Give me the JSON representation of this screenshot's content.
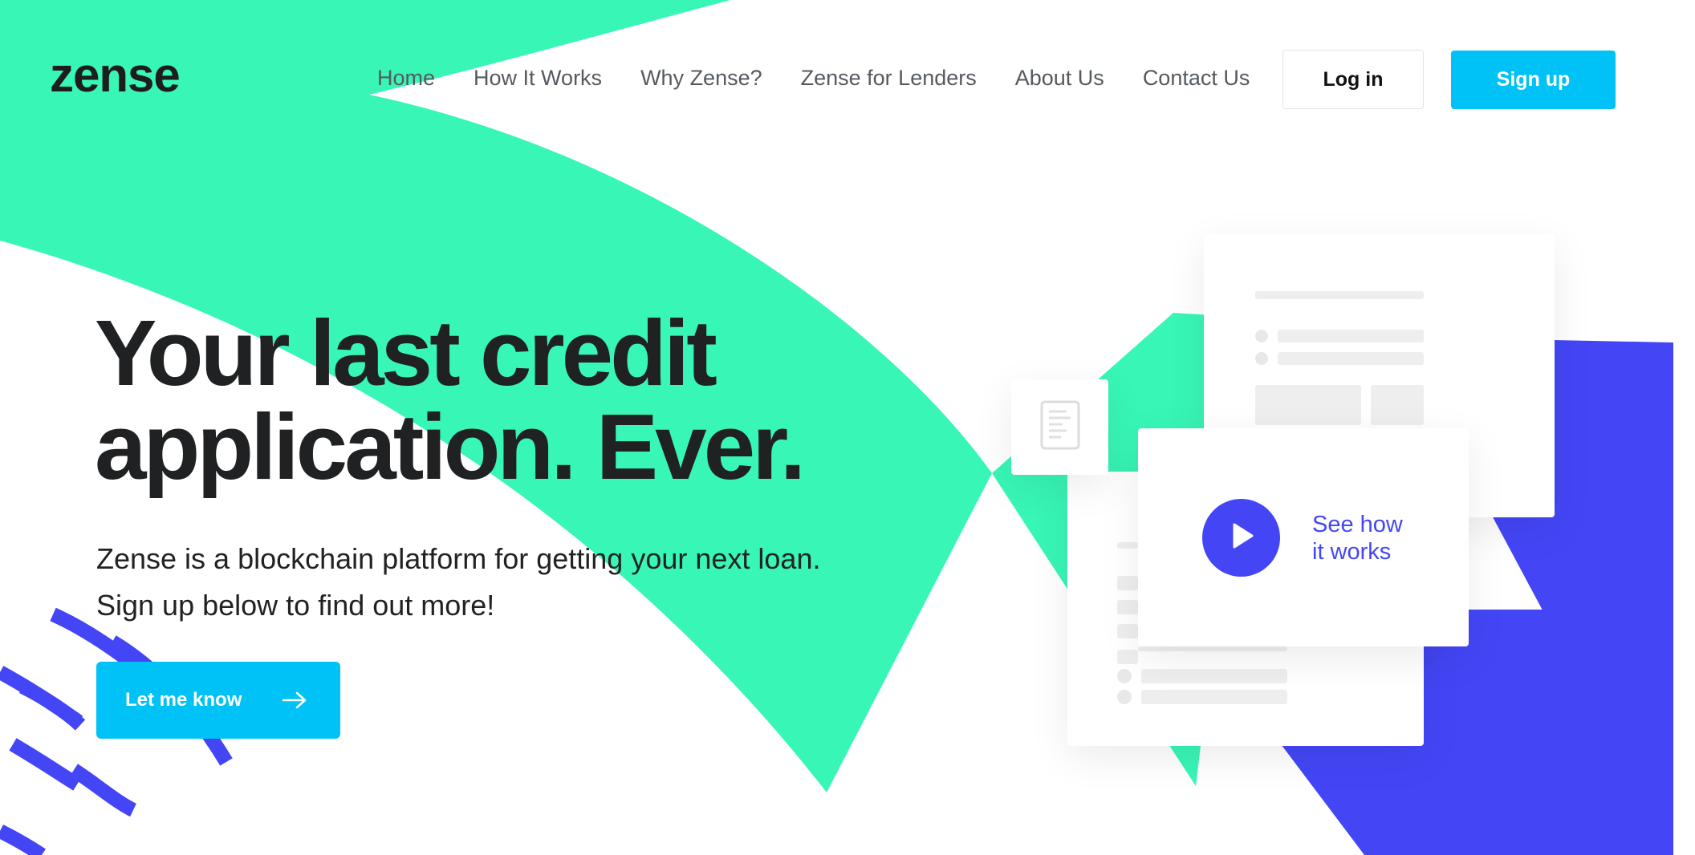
{
  "brand": {
    "logo_text": "zense",
    "colors": {
      "mint": "#38f6b6",
      "indigo": "#4446f6",
      "cyan": "#00c2f6",
      "text_dark": "#1f2122"
    }
  },
  "nav": {
    "items": [
      {
        "label": "Home"
      },
      {
        "label": "How It Works"
      },
      {
        "label": "Why Zense?"
      },
      {
        "label": "Zense for Lenders"
      },
      {
        "label": "About Us"
      },
      {
        "label": "Contact Us"
      }
    ],
    "login_label": "Log in",
    "signup_label": "Sign up"
  },
  "hero": {
    "title_line1": "Your last credit",
    "title_line2": "application. Ever.",
    "desc_line1": "Zense is a blockchain platform for getting your next loan.",
    "desc_line2": "Sign up below to find out more!",
    "cta_label": "Let me know",
    "cta_icon": "arrow-right-icon"
  },
  "illustration": {
    "play_icon": "play-icon",
    "doc_icon": "document-icon",
    "see_how_line1": "See how",
    "see_how_line2": "it works"
  }
}
